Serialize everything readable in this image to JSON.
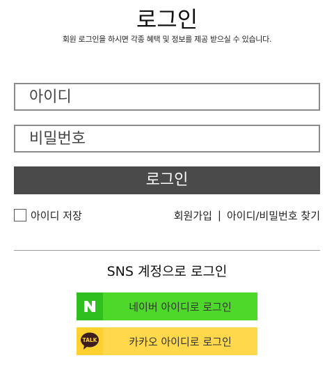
{
  "header": {
    "title": "로그인",
    "subtitle": "회원 로그인을 하시면 각종 혜택 및 정보를 제공 받으실 수 있습니다."
  },
  "form": {
    "id_placeholder": "아이디",
    "id_value": "",
    "pw_placeholder": "비밀번호",
    "pw_value": "",
    "login_label": "로그인",
    "remember_label": "아이디 저장",
    "remember_checked": false
  },
  "links": {
    "join": "회원가입",
    "separator": "|",
    "find": "아이디/비밀번호 찾기"
  },
  "sns": {
    "title": "SNS 계정으로 로그인",
    "naver": {
      "label": "네이버 아이디로 로그인",
      "icon": "naver-logo-icon",
      "color": "#4ed829"
    },
    "kakao": {
      "label": "카카오 아이디로 로그인",
      "icon": "kakao-talk-logo-icon",
      "logo_text": "TALK",
      "color": "#ffd84c"
    }
  },
  "colors": {
    "login_button": "#4a4a4a",
    "field_border": "#8a8a8a"
  }
}
